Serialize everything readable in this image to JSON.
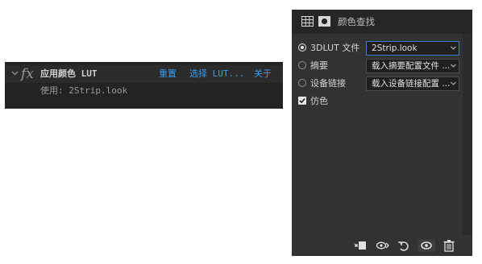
{
  "effect": {
    "name": "应用颜色 LUT",
    "reset_label": "重置",
    "choose_lut_label": "选择 LUT...",
    "about_label": "关于",
    "usage_text": "使用: 2Strip.look"
  },
  "adjust_panel": {
    "title": "颜色查找",
    "rows": [
      {
        "label": "3DLUT 文件",
        "value": "2Strip.look",
        "selected": true
      },
      {
        "label": "摘要",
        "value": "载入摘要配置文件 ..."
      },
      {
        "label": "设备链接",
        "value": "载入设备链接配置 ..."
      }
    ],
    "dither": {
      "label": "仿色",
      "checked": true
    },
    "footer_icons": [
      "clip-to-layer-icon",
      "view-previous-state-icon",
      "reset-icon",
      "visibility-icon",
      "trash-icon"
    ]
  },
  "colors": {
    "link": "#3a9bf0",
    "focus": "#3f7bd4",
    "panel": "#323232"
  }
}
